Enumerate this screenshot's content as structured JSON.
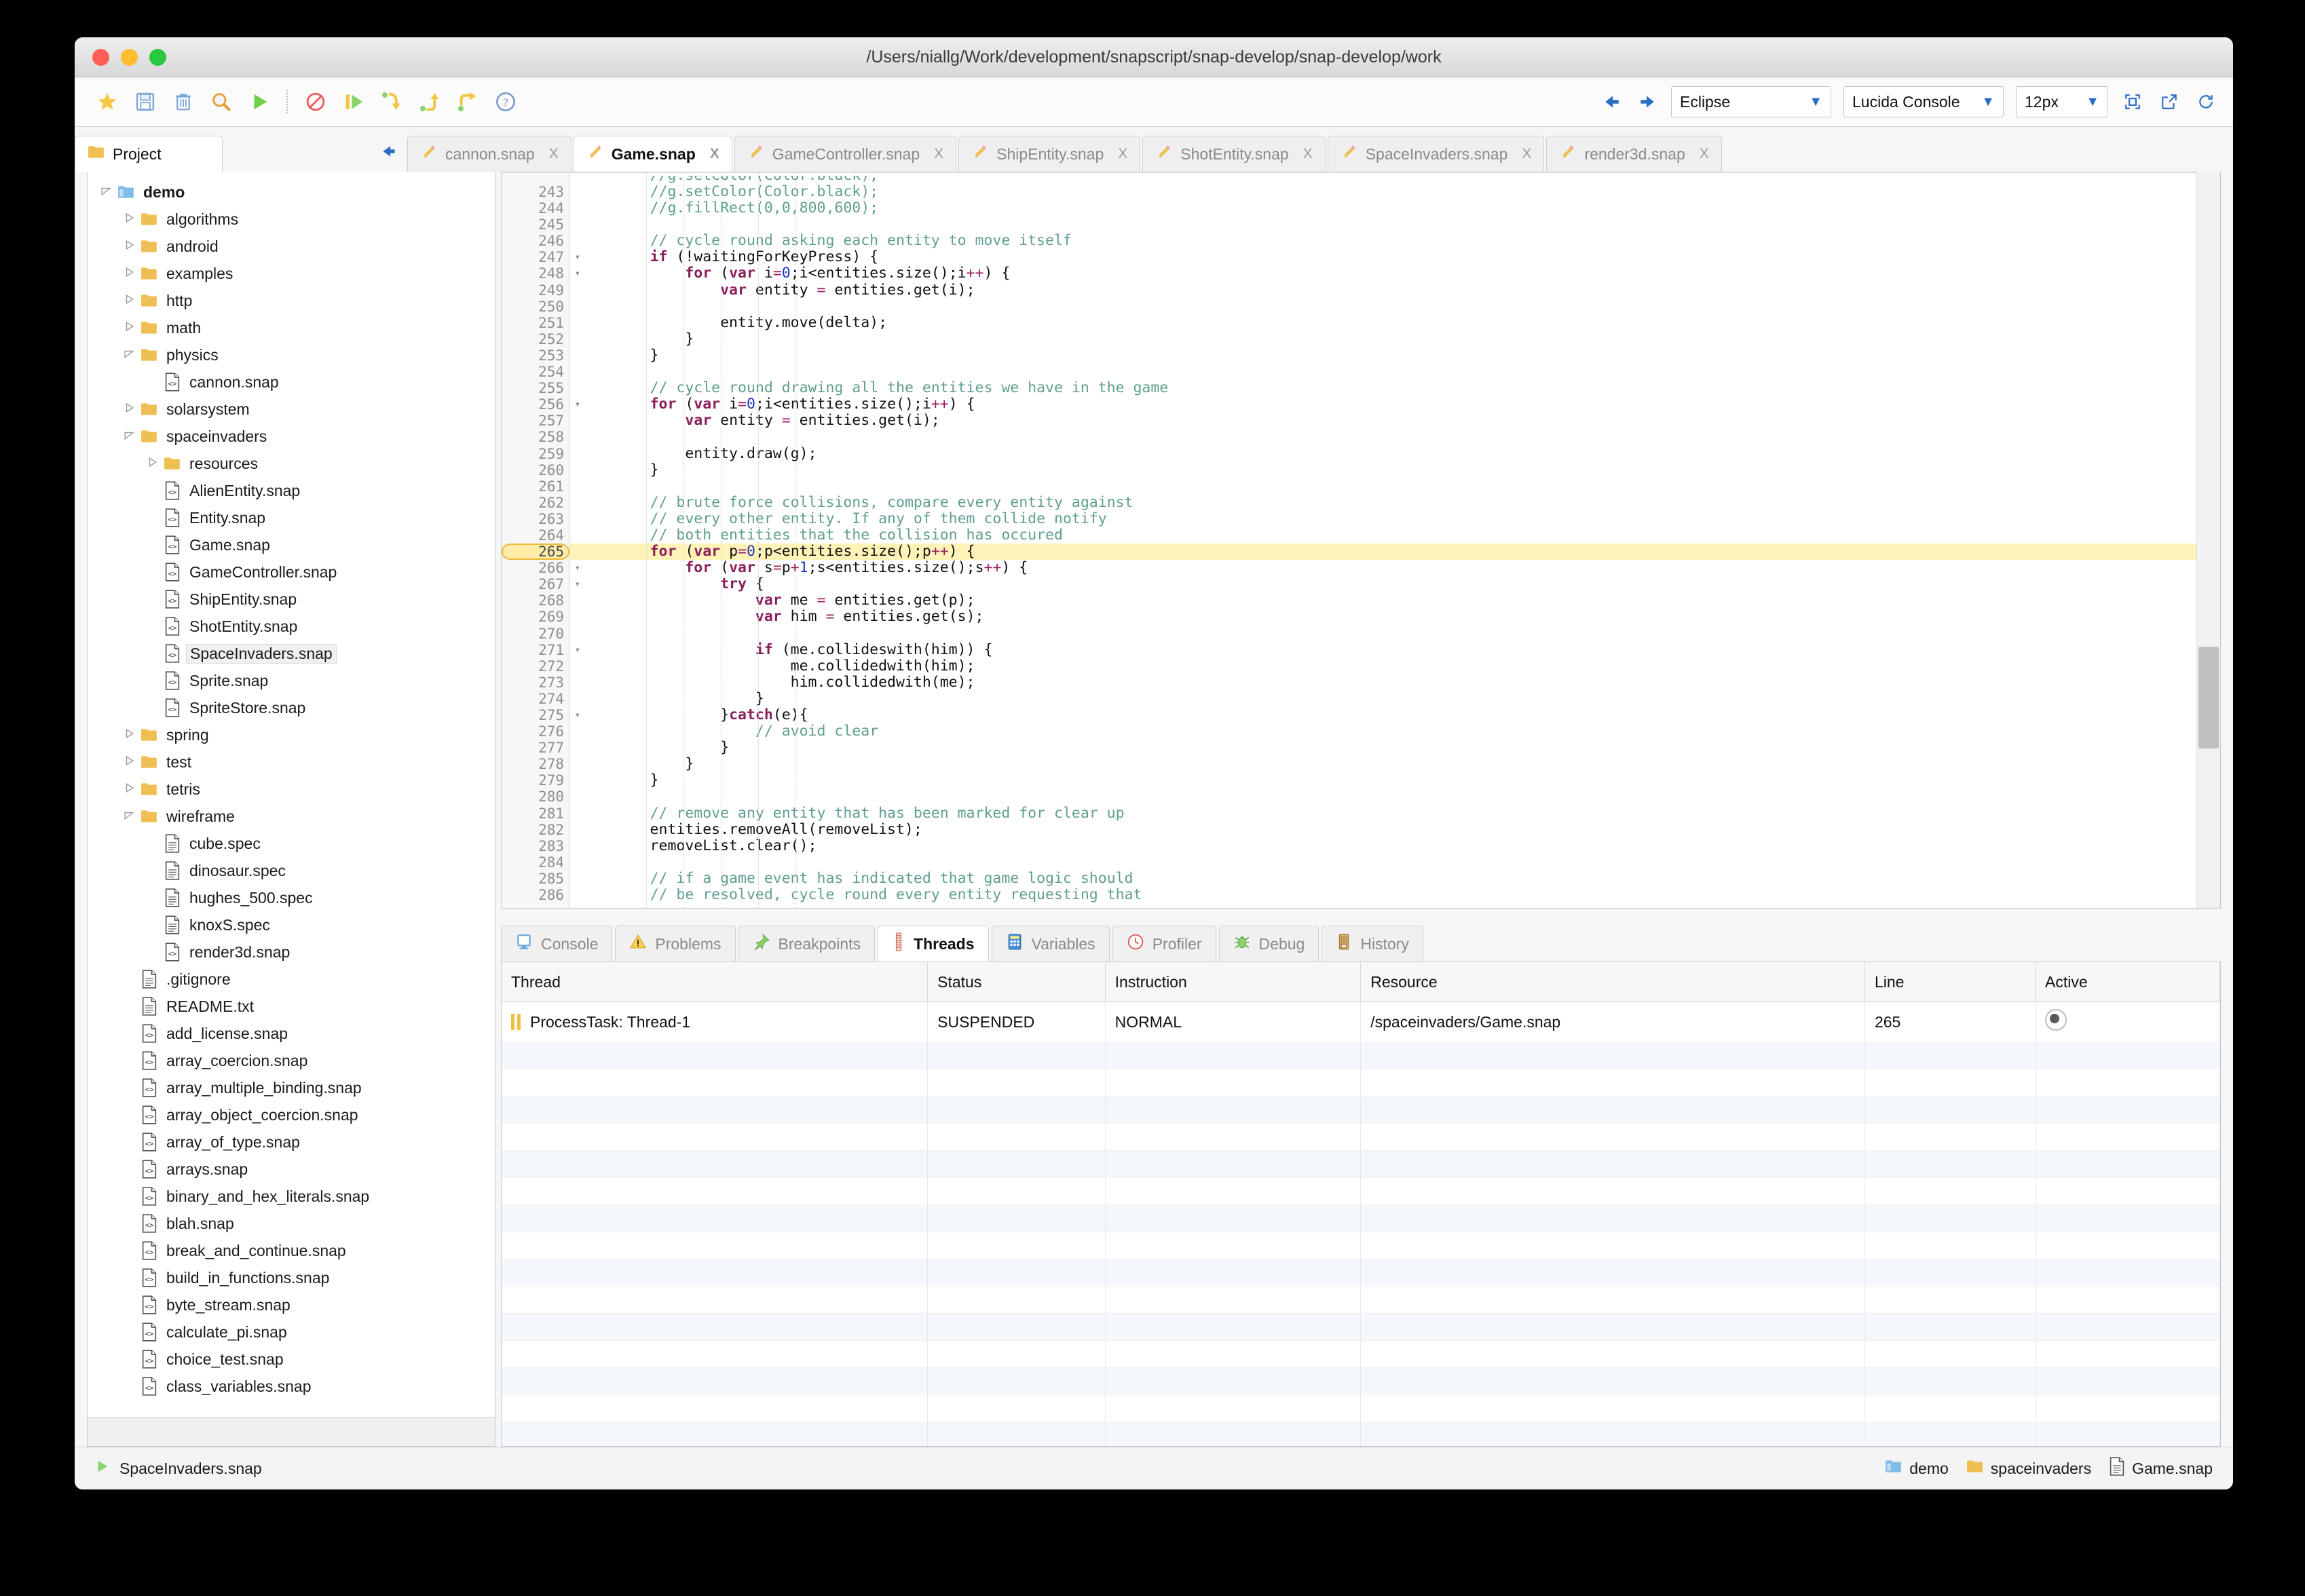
{
  "window": {
    "title": "/Users/niallg/Work/development/snapscript/snap-develop/snap-develop/work"
  },
  "toolbar": {
    "buttons": [
      {
        "name": "bookmark-star-icon",
        "label": "Bookmark"
      },
      {
        "name": "save-icon",
        "label": "Save"
      },
      {
        "name": "delete-trash-icon",
        "label": "Delete"
      },
      {
        "name": "search-icon",
        "label": "Search"
      },
      {
        "name": "run-play-icon",
        "label": "Run"
      },
      {
        "name": "stop-icon",
        "label": "Stop"
      },
      {
        "name": "resume-icon",
        "label": "Resume"
      },
      {
        "name": "step-over-icon",
        "label": "Step Over"
      },
      {
        "name": "step-in-icon",
        "label": "Step In"
      },
      {
        "name": "step-out-icon",
        "label": "Step Out"
      },
      {
        "name": "help-icon",
        "label": "Help"
      }
    ],
    "nav_back": "back-arrow-icon",
    "nav_forward": "forward-arrow-icon",
    "theme_select": {
      "value": "Eclipse",
      "caret": "↓"
    },
    "font_select": {
      "value": "Lucida Console",
      "caret": "↓"
    },
    "size_select": {
      "value": "12px",
      "caret": "↓"
    },
    "right_icons": [
      {
        "name": "fullscreen-icon"
      },
      {
        "name": "open-external-icon"
      },
      {
        "name": "refresh-icon"
      }
    ]
  },
  "tabstrip": {
    "project_tab": {
      "label": "Project",
      "icon": "folder-icon"
    },
    "collapse_arrow": "left-arrow-icon",
    "editor_tabs": [
      {
        "label": "cannon.snap",
        "active": false,
        "close": "X"
      },
      {
        "label": "Game.snap",
        "active": true,
        "close": "X"
      },
      {
        "label": "GameController.snap",
        "active": false,
        "close": "X"
      },
      {
        "label": "ShipEntity.snap",
        "active": false,
        "close": "X"
      },
      {
        "label": "ShotEntity.snap",
        "active": false,
        "close": "X"
      },
      {
        "label": "SpaceInvaders.snap",
        "active": false,
        "close": "X"
      },
      {
        "label": "render3d.snap",
        "active": false,
        "close": "X"
      }
    ]
  },
  "tree": {
    "items": [
      {
        "label": "demo",
        "depth": 0,
        "icon": "project-folder-icon",
        "twisty": "open",
        "bold": true
      },
      {
        "label": "algorithms",
        "depth": 1,
        "icon": "folder-icon",
        "twisty": "closed"
      },
      {
        "label": "android",
        "depth": 1,
        "icon": "folder-icon",
        "twisty": "closed"
      },
      {
        "label": "examples",
        "depth": 1,
        "icon": "folder-icon",
        "twisty": "closed"
      },
      {
        "label": "http",
        "depth": 1,
        "icon": "folder-icon",
        "twisty": "closed"
      },
      {
        "label": "math",
        "depth": 1,
        "icon": "folder-icon",
        "twisty": "closed"
      },
      {
        "label": "physics",
        "depth": 1,
        "icon": "folder-icon",
        "twisty": "open"
      },
      {
        "label": "cannon.snap",
        "depth": 2,
        "icon": "code-file-icon",
        "twisty": "none"
      },
      {
        "label": "solarsystem",
        "depth": 1,
        "icon": "folder-icon",
        "twisty": "closed"
      },
      {
        "label": "spaceinvaders",
        "depth": 1,
        "icon": "folder-icon",
        "twisty": "open"
      },
      {
        "label": "resources",
        "depth": 2,
        "icon": "folder-icon",
        "twisty": "closed"
      },
      {
        "label": "AlienEntity.snap",
        "depth": 2,
        "icon": "code-file-icon",
        "twisty": "none"
      },
      {
        "label": "Entity.snap",
        "depth": 2,
        "icon": "code-file-icon",
        "twisty": "none"
      },
      {
        "label": "Game.snap",
        "depth": 2,
        "icon": "code-file-icon",
        "twisty": "none"
      },
      {
        "label": "GameController.snap",
        "depth": 2,
        "icon": "code-file-icon",
        "twisty": "none"
      },
      {
        "label": "ShipEntity.snap",
        "depth": 2,
        "icon": "code-file-icon",
        "twisty": "none"
      },
      {
        "label": "ShotEntity.snap",
        "depth": 2,
        "icon": "code-file-icon",
        "twisty": "none"
      },
      {
        "label": "SpaceInvaders.snap",
        "depth": 2,
        "icon": "code-file-icon",
        "twisty": "none",
        "selected": true
      },
      {
        "label": "Sprite.snap",
        "depth": 2,
        "icon": "code-file-icon",
        "twisty": "none"
      },
      {
        "label": "SpriteStore.snap",
        "depth": 2,
        "icon": "code-file-icon",
        "twisty": "none"
      },
      {
        "label": "spring",
        "depth": 1,
        "icon": "folder-icon",
        "twisty": "closed"
      },
      {
        "label": "test",
        "depth": 1,
        "icon": "folder-icon",
        "twisty": "closed"
      },
      {
        "label": "tetris",
        "depth": 1,
        "icon": "folder-icon",
        "twisty": "closed"
      },
      {
        "label": "wireframe",
        "depth": 1,
        "icon": "folder-icon",
        "twisty": "open"
      },
      {
        "label": "cube.spec",
        "depth": 2,
        "icon": "text-file-icon",
        "twisty": "none"
      },
      {
        "label": "dinosaur.spec",
        "depth": 2,
        "icon": "text-file-icon",
        "twisty": "none"
      },
      {
        "label": "hughes_500.spec",
        "depth": 2,
        "icon": "text-file-icon",
        "twisty": "none"
      },
      {
        "label": "knoxS.spec",
        "depth": 2,
        "icon": "text-file-icon",
        "twisty": "none"
      },
      {
        "label": "render3d.snap",
        "depth": 2,
        "icon": "code-file-icon",
        "twisty": "none"
      },
      {
        "label": ".gitignore",
        "depth": 1,
        "icon": "text-file-icon",
        "twisty": "none"
      },
      {
        "label": "README.txt",
        "depth": 1,
        "icon": "text-file-icon",
        "twisty": "none"
      },
      {
        "label": "add_license.snap",
        "depth": 1,
        "icon": "code-file-icon",
        "twisty": "none"
      },
      {
        "label": "array_coercion.snap",
        "depth": 1,
        "icon": "code-file-icon",
        "twisty": "none"
      },
      {
        "label": "array_multiple_binding.snap",
        "depth": 1,
        "icon": "code-file-icon",
        "twisty": "none"
      },
      {
        "label": "array_object_coercion.snap",
        "depth": 1,
        "icon": "code-file-icon",
        "twisty": "none"
      },
      {
        "label": "array_of_type.snap",
        "depth": 1,
        "icon": "code-file-icon",
        "twisty": "none"
      },
      {
        "label": "arrays.snap",
        "depth": 1,
        "icon": "code-file-icon",
        "twisty": "none"
      },
      {
        "label": "binary_and_hex_literals.snap",
        "depth": 1,
        "icon": "code-file-icon",
        "twisty": "none"
      },
      {
        "label": "blah.snap",
        "depth": 1,
        "icon": "code-file-icon",
        "twisty": "none"
      },
      {
        "label": "break_and_continue.snap",
        "depth": 1,
        "icon": "code-file-icon",
        "twisty": "none"
      },
      {
        "label": "build_in_functions.snap",
        "depth": 1,
        "icon": "code-file-icon",
        "twisty": "none"
      },
      {
        "label": "byte_stream.snap",
        "depth": 1,
        "icon": "code-file-icon",
        "twisty": "none"
      },
      {
        "label": "calculate_pi.snap",
        "depth": 1,
        "icon": "code-file-icon",
        "twisty": "none"
      },
      {
        "label": "choice_test.snap",
        "depth": 1,
        "icon": "code-file-icon",
        "twisty": "none"
      },
      {
        "label": "class_variables.snap",
        "depth": 1,
        "icon": "code-file-icon",
        "twisty": "none"
      }
    ]
  },
  "editor": {
    "first_line": 243,
    "highlight_line": 265,
    "fold_lines": [
      247,
      248,
      256,
      265,
      266,
      267,
      271,
      275
    ],
    "partial_top": "//g.setColor(Color.black);",
    "lines": [
      {
        "n": 243,
        "html": "        <c>//g.setColor(Color.black);</c>"
      },
      {
        "n": 244,
        "html": "        <c>//g.fillRect(0,0,800,600);</c>"
      },
      {
        "n": 245,
        "html": ""
      },
      {
        "n": 246,
        "html": "        <c>// cycle round asking each entity to move itself</c>"
      },
      {
        "n": 247,
        "html": "        <k>if</k> (!waitingForKeyPress) {"
      },
      {
        "n": 248,
        "html": "            <k>for</k> (<k>var</k> i<o>=</o><nm>0</nm>;i&lt;entities.size();i<o>++</o>) {"
      },
      {
        "n": 249,
        "html": "                <k>var</k> entity <o>=</o> entities.get(i);"
      },
      {
        "n": 250,
        "html": ""
      },
      {
        "n": 251,
        "html": "                entity.move(delta);"
      },
      {
        "n": 252,
        "html": "            }"
      },
      {
        "n": 253,
        "html": "        }"
      },
      {
        "n": 254,
        "html": ""
      },
      {
        "n": 255,
        "html": "        <c>// cycle round drawing all the entities we have in the game</c>"
      },
      {
        "n": 256,
        "html": "        <k>for</k> (<k>var</k> i<o>=</o><nm>0</nm>;i&lt;entities.size();i<o>++</o>) {"
      },
      {
        "n": 257,
        "html": "            <k>var</k> entity <o>=</o> entities.get(i);"
      },
      {
        "n": 258,
        "html": ""
      },
      {
        "n": 259,
        "html": "            entity.draw(g);"
      },
      {
        "n": 260,
        "html": "        }"
      },
      {
        "n": 261,
        "html": ""
      },
      {
        "n": 262,
        "html": "        <c>// brute force collisions, compare every entity against</c>"
      },
      {
        "n": 263,
        "html": "        <c>// every other entity. If any of them collide notify</c>"
      },
      {
        "n": 264,
        "html": "        <c>// both entities that the collision has occured</c>"
      },
      {
        "n": 265,
        "html": "        <k>for</k> (<k>var</k> p<o>=</o><nm>0</nm>;p&lt;entities.size();p<o>++</o>) {"
      },
      {
        "n": 266,
        "html": "            <k>for</k> (<k>var</k> s<o>=</o>p<o>+</o><nm>1</nm>;s&lt;entities.size();s<o>++</o>) {"
      },
      {
        "n": 267,
        "html": "                <k>try</k> {"
      },
      {
        "n": 268,
        "html": "                    <k>var</k> me <o>=</o> entities.get(p);"
      },
      {
        "n": 269,
        "html": "                    <k>var</k> him <o>=</o> entities.get(s);"
      },
      {
        "n": 270,
        "html": ""
      },
      {
        "n": 271,
        "html": "                    <k>if</k> (me.collideswith(him)) {"
      },
      {
        "n": 272,
        "html": "                        me.collidedwith(him);"
      },
      {
        "n": 273,
        "html": "                        him.collidedwith(me);"
      },
      {
        "n": 274,
        "html": "                    }"
      },
      {
        "n": 275,
        "html": "                }<k>catch</k>(e){"
      },
      {
        "n": 276,
        "html": "                    <c>// avoid clear</c>"
      },
      {
        "n": 277,
        "html": "                }"
      },
      {
        "n": 278,
        "html": "            }"
      },
      {
        "n": 279,
        "html": "        }"
      },
      {
        "n": 280,
        "html": ""
      },
      {
        "n": 281,
        "html": "        <c>// remove any entity that has been marked for clear up</c>"
      },
      {
        "n": 282,
        "html": "        entities.removeAll(removeList);"
      },
      {
        "n": 283,
        "html": "        removeList.clear();"
      },
      {
        "n": 284,
        "html": ""
      },
      {
        "n": 285,
        "html": "        <c>// if a game event has indicated that game logic should</c>"
      },
      {
        "n": 286,
        "html": "        <c>// be resolved, cycle round every entity requesting that</c>"
      }
    ]
  },
  "bottom_panel": {
    "tabs": [
      {
        "label": "Console",
        "icon": "console-icon",
        "active": false
      },
      {
        "label": "Problems",
        "icon": "warning-icon",
        "active": false
      },
      {
        "label": "Breakpoints",
        "icon": "pin-icon",
        "active": false
      },
      {
        "label": "Threads",
        "icon": "thread-icon",
        "active": true
      },
      {
        "label": "Variables",
        "icon": "calculator-icon",
        "active": false
      },
      {
        "label": "Profiler",
        "icon": "clock-icon",
        "active": false
      },
      {
        "label": "Debug",
        "icon": "bug-icon",
        "active": false
      },
      {
        "label": "History",
        "icon": "history-icon",
        "active": false
      }
    ],
    "threads_table": {
      "columns": [
        "Thread",
        "Status",
        "Instruction",
        "Resource",
        "Line",
        "Active"
      ],
      "rows": [
        {
          "thread": "ProcessTask: Thread-1",
          "status": "SUSPENDED",
          "instruction": "NORMAL",
          "resource": "/spaceinvaders/Game.snap",
          "line": "265",
          "active": true
        }
      ],
      "empty_rows": 15
    }
  },
  "status_bar": {
    "run_icon": "play-icon",
    "run_label": "SpaceInvaders.snap",
    "breadcrumb": [
      {
        "label": "demo",
        "icon": "project-folder-icon"
      },
      {
        "label": "spaceinvaders",
        "icon": "folder-icon"
      },
      {
        "label": "Game.snap",
        "icon": "text-file-icon"
      }
    ]
  },
  "colors": {
    "accent_blue": "#2a6ec4",
    "folder_gold": "#f0bf53",
    "highlight_yellow": "#fff3b8",
    "comment_green": "#5f9e8f",
    "keyword_magenta": "#8a1f5a",
    "number_blue": "#1a37c8"
  }
}
